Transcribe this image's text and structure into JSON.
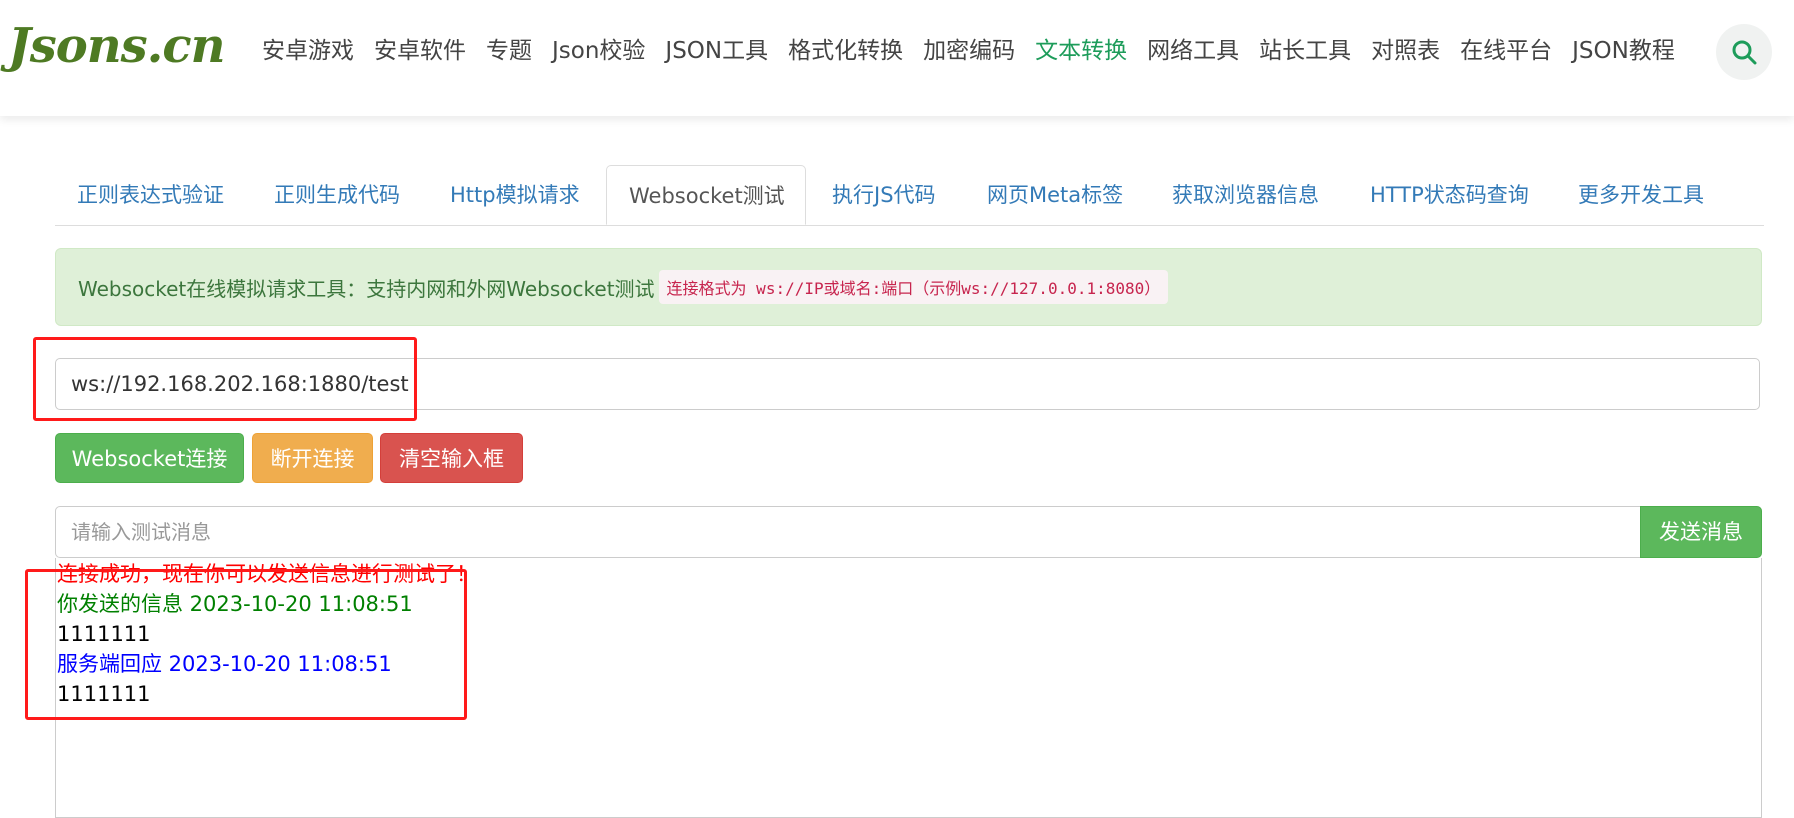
{
  "header": {
    "logo": "Jsons.cn",
    "nav": [
      "安卓游戏",
      "安卓软件",
      "专题",
      "Json校验",
      "JSON工具",
      "格式化转换",
      "加密编码",
      "文本转换",
      "网络工具",
      "站长工具",
      "对照表",
      "在线平台",
      "JSON教程"
    ],
    "active_nav": "文本转换",
    "search_icon": "search-icon"
  },
  "tabs": [
    "正则表达式验证",
    "正则生成代码",
    "Http模拟请求",
    "Websocket测试",
    "执行JS代码",
    "网页Meta标签",
    "获取浏览器信息",
    "HTTP状态码查询",
    "更多开发工具"
  ],
  "active_tab": "Websocket测试",
  "alert": {
    "text": "Websocket在线模拟请求工具：支持内网和外网Websocket测试",
    "code": "连接格式为 ws://IP或域名:端口（示例ws://127.0.0.1:8080）"
  },
  "url_input": {
    "value": "ws://192.168.202.168:1880/test"
  },
  "buttons": {
    "connect": "Websocket连接",
    "disconnect": "断开连接",
    "clear": "清空输入框"
  },
  "message_input": {
    "placeholder": "请输入测试消息",
    "send": "发送消息"
  },
  "log": [
    {
      "text": "连接成功，现在你可以发送信息进行测试了！",
      "color": "red"
    },
    {
      "text": "你发送的信息 2023-10-20 11:08:51",
      "color": "green"
    },
    {
      "text": "1111111",
      "color": "black"
    },
    {
      "text": "服务端回应 2023-10-20 11:08:51",
      "color": "blue"
    },
    {
      "text": "1111111",
      "color": "black"
    }
  ],
  "colors": {
    "brand": "#4e7a23",
    "nav_active": "#1d9c5a",
    "success": "#5cb85c",
    "warning": "#f0ad4e",
    "danger": "#d9534f",
    "annotation": "#ff1a1a"
  }
}
